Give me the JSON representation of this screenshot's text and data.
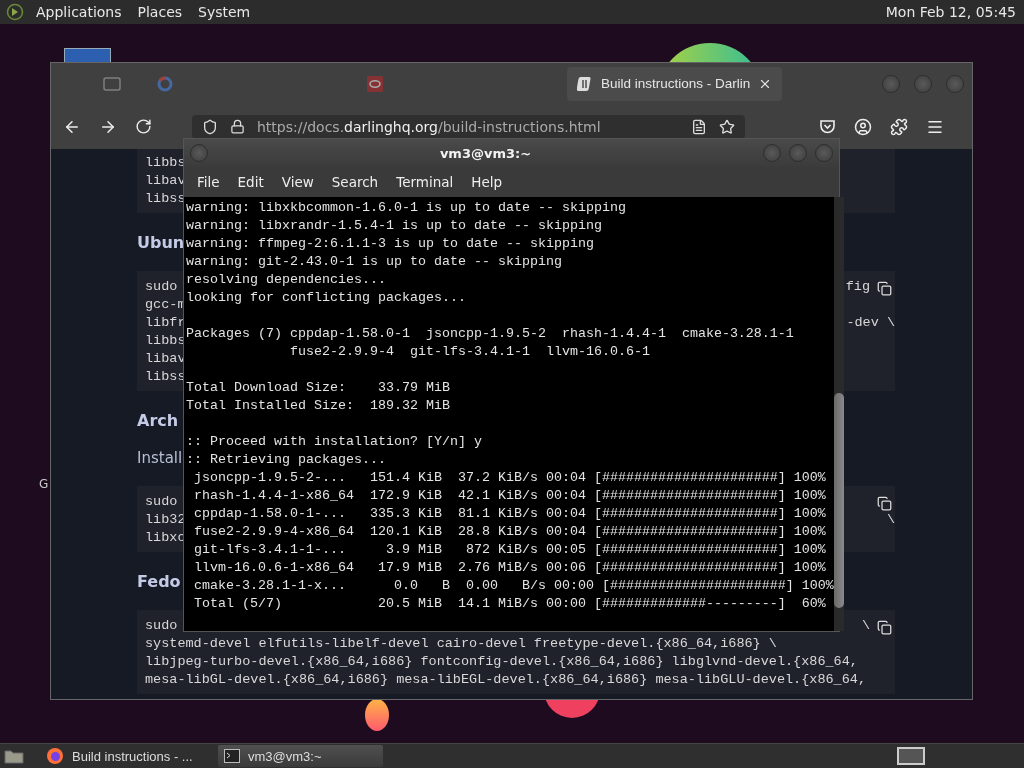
{
  "top_panel": {
    "menus": [
      "Applications",
      "Places",
      "System"
    ],
    "clock": "Mon Feb 12, 05:45"
  },
  "desktop": {
    "icon_label": "G"
  },
  "browser": {
    "tabs": [
      {
        "kind": "google",
        "selected": false
      },
      {
        "kind": "oracle",
        "selected": false
      },
      {
        "kind": "book",
        "title": "Build instructions - Darlin",
        "selected": true
      }
    ],
    "url": [
      "https://docs.",
      "darlinghq.org",
      "/build-instructions.html"
    ],
    "blocks": [
      {
        "kind": "code",
        "copy": false,
        "lines": [
          {
            "text": "libbs"
          },
          {
            "text": "libav"
          },
          {
            "text": "libss"
          }
        ]
      },
      {
        "kind": "heading",
        "text": "Ubun"
      },
      {
        "kind": "code",
        "copy": true,
        "lines": [
          {
            "text": "sudo",
            "tail": "fig"
          },
          {
            "text": "gcc-m"
          },
          {
            "text": "libfr",
            "tail": "-dev \\"
          },
          {
            "text": "libbs"
          },
          {
            "text": "libav"
          },
          {
            "text": "libss"
          }
        ]
      },
      {
        "kind": "heading",
        "text": "Arch"
      },
      {
        "kind": "paragraph",
        "text": "Install"
      },
      {
        "kind": "code",
        "copy": true,
        "lines": [
          {
            "text": "sudo"
          },
          {
            "text": "lib32",
            "tail": "\\"
          },
          {
            "text": "libxc"
          }
        ]
      },
      {
        "kind": "heading",
        "text": "Fedo"
      },
      {
        "kind": "code",
        "copy": true,
        "lines": [
          {
            "text": "sudo",
            "tail": "\\"
          },
          {
            "text": "systemd-devel elfutils-libelf-devel cairo-devel freetype-devel.{x86_64,i686} \\"
          },
          {
            "text": "libjpeg-turbo-devel.{x86_64,i686} fontconfig-devel.{x86_64,i686} libglvnd-devel.{x86_64,"
          },
          {
            "text": "mesa-libGL-devel.{x86_64,i686} mesa-libEGL-devel.{x86_64,i686} mesa-libGLU-devel.{x86_64,"
          }
        ]
      }
    ]
  },
  "terminal": {
    "title": "vm3@vm3:~",
    "menus": [
      "File",
      "Edit",
      "View",
      "Search",
      "Terminal",
      "Help"
    ],
    "output": [
      [
        "warning: libxkbcommon-1.6.0-1 is up to date -- skipping",
        "warning: libxrandr-1.5.4-1 is up to date -- skipping",
        "warning: ffmpeg-2:6.1.1-3 is up to date -- skipping",
        "warning: git-2.43.0-1 is up to date -- skipping",
        "resolving dependencies...",
        "looking for conflicting packages..."
      ],
      [
        "Packages (7) cppdap-1.58.0-1  jsoncpp-1.9.5-2  rhash-1.4.4-1  cmake-3.28.1-1",
        "             fuse2-2.9.9-4  git-lfs-3.4.1-1  llvm-16.0.6-1"
      ],
      [
        "Total Download Size:    33.79 MiB",
        "Total Installed Size:  189.32 MiB"
      ],
      [
        ":: Proceed with installation? [Y/n] y",
        ":: Retrieving packages...",
        " jsoncpp-1.9.5-2-...   151.4 KiB  37.2 KiB/s 00:04 [######################] 100%",
        " rhash-1.4.4-1-x86_64  172.9 KiB  42.1 KiB/s 00:04 [######################] 100%",
        " cppdap-1.58.0-1-...   335.3 KiB  81.1 KiB/s 00:04 [######################] 100%",
        " fuse2-2.9.9-4-x86_64  120.1 KiB  28.8 KiB/s 00:04 [######################] 100%",
        " git-lfs-3.4.1-1-...     3.9 MiB   872 KiB/s 00:05 [######################] 100%",
        " llvm-16.0.6-1-x86_64   17.9 MiB  2.76 MiB/s 00:06 [######################] 100%",
        " cmake-3.28.1-1-x...      0.0   B  0.00   B/s 00:00 [######################] 100%",
        " Total (5/7)            20.5 MiB  14.1 MiB/s 00:00 [#############---------]  60%"
      ]
    ]
  },
  "taskbar": {
    "tasks": [
      {
        "kind": "browser",
        "title": "Build instructions - ...",
        "selected": false
      },
      {
        "kind": "terminal",
        "title": "vm3@vm3:~",
        "selected": true
      }
    ]
  }
}
